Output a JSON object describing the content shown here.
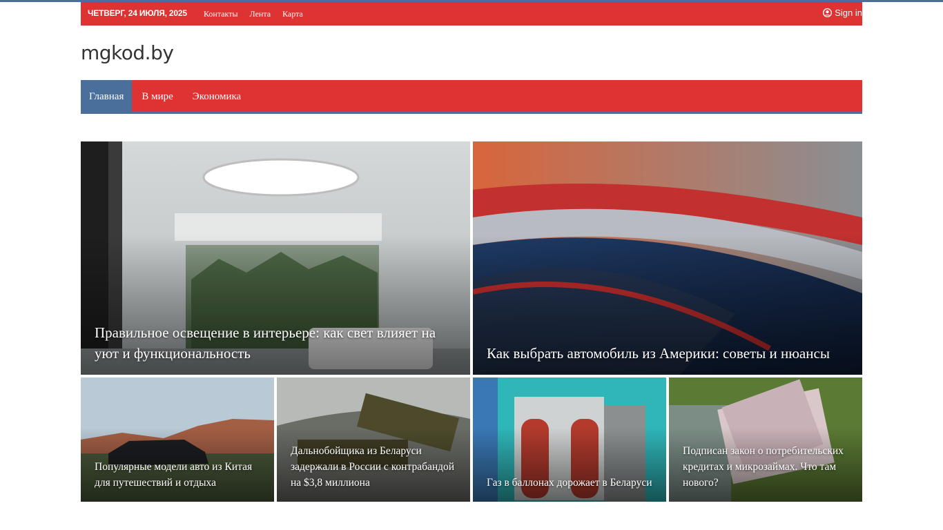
{
  "topbar": {
    "date": "ЧЕТВЕРГ, 24 ИЮЛЯ, 2025",
    "links": [
      "Контакты",
      "Лента",
      "Карта"
    ],
    "signin": "Sign in"
  },
  "site": {
    "logo": "mgkod.by"
  },
  "nav": {
    "items": [
      "Главная",
      "В мире",
      "Экономика"
    ]
  },
  "featured": [
    {
      "title": "Правильное освещение в интерьере: как свет влияет на уют и функциональность"
    },
    {
      "title": "Как выбрать автомобиль из Америки: советы и нюансы"
    },
    {
      "title": "Популярные модели авто из Китая для путешествий и отдыха"
    },
    {
      "title": "Дальнобойщика из Беларуси задержали в России с контрабандой на $3,8 миллиона"
    },
    {
      "title": "Газ в баллонах дорожает в Беларуси"
    },
    {
      "title": "Подписан закон о потребительских кредитах и микрозаймах. Что там нового?"
    }
  ],
  "colors": {
    "brand_red": "#dd3333",
    "accent_blue": "#4a6f9a"
  }
}
